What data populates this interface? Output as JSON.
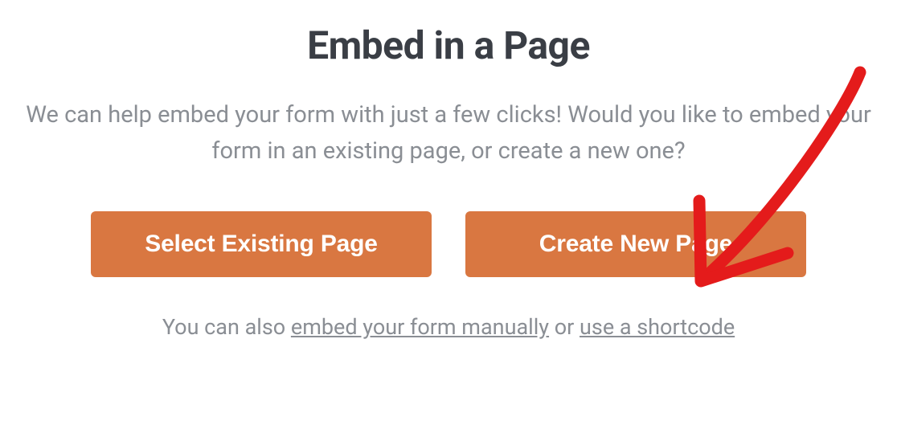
{
  "modal": {
    "title": "Embed in a Page",
    "description": "We can help embed your form with just a few clicks! Would you like to embed your form in an existing page, or create a new one?",
    "buttons": {
      "select_existing_label": "Select Existing Page",
      "create_new_label": "Create New Page"
    },
    "footer": {
      "prefix": "You can also ",
      "link_manual": "embed your form manually",
      "middle": " or ",
      "link_shortcode": "use a shortcode"
    }
  },
  "annotation": {
    "color": "#e41b1b",
    "target": "create-new-page-button"
  }
}
